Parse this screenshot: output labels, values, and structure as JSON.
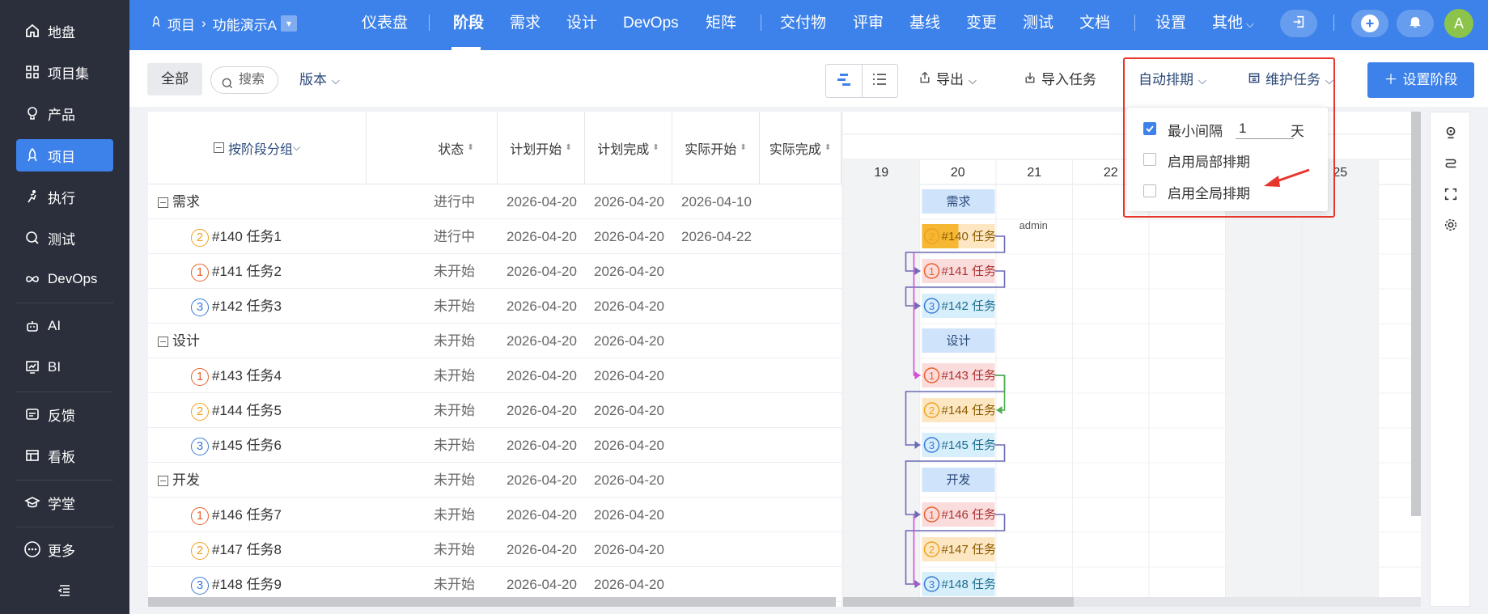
{
  "sidebar": {
    "items": [
      {
        "label": "地盘",
        "icon": "home-icon"
      },
      {
        "label": "项目集",
        "icon": "grid-icon"
      },
      {
        "label": "产品",
        "icon": "bulb-icon"
      },
      {
        "label": "项目",
        "icon": "rocket-icon"
      },
      {
        "label": "执行",
        "icon": "run-icon"
      },
      {
        "label": "测试",
        "icon": "test-icon"
      },
      {
        "label": "DevOps",
        "icon": "infinity-icon"
      },
      {
        "label": "AI",
        "icon": "robot-icon"
      },
      {
        "label": "BI",
        "icon": "chart-icon"
      },
      {
        "label": "反馈",
        "icon": "feedback-icon"
      },
      {
        "label": "看板",
        "icon": "kanban-icon"
      },
      {
        "label": "学堂",
        "icon": "school-icon"
      },
      {
        "label": "更多",
        "icon": "more-icon"
      }
    ],
    "collapse_icon": "collapse-icon"
  },
  "topbar": {
    "breadcrumb": [
      "项目",
      "功能演示A"
    ],
    "nav": [
      "仪表盘",
      "阶段",
      "需求",
      "设计",
      "DevOps",
      "矩阵",
      "交付物",
      "评审",
      "基线",
      "变更",
      "测试",
      "文档",
      "设置",
      "其他"
    ],
    "active": "阶段",
    "avatar": "A"
  },
  "toolbar": {
    "all": "全部",
    "search_placeholder": "搜索",
    "version": "版本",
    "export": "导出",
    "import": "导入任务",
    "auto_schedule": "自动排期",
    "maintain": "维护任务",
    "set_phase": "设置阶段"
  },
  "popup": {
    "min_gap_label": "最小间隔",
    "min_gap_value": "1",
    "min_gap_unit": "天",
    "local": "启用局部排期",
    "global": "启用全局排期"
  },
  "grid": {
    "headers": {
      "group": "按阶段分组",
      "status": "状态",
      "plan_start": "计划开始",
      "plan_end": "计划完成",
      "actual_start": "实际开始",
      "actual_end": "实际完成"
    },
    "rows": [
      {
        "type": "phase",
        "name": "需求",
        "status": "进行中",
        "ps": "2026-04-20",
        "pe": "2026-04-20",
        "as": "2026-04-10"
      },
      {
        "type": "task",
        "pri": "2",
        "name": "#140 任务1",
        "status": "进行中",
        "ps": "2026-04-20",
        "pe": "2026-04-20",
        "as": "2026-04-22"
      },
      {
        "type": "task",
        "pri": "1",
        "name": "#141 任务2",
        "status": "未开始",
        "ps": "2026-04-20",
        "pe": "2026-04-20",
        "as": ""
      },
      {
        "type": "task",
        "pri": "3",
        "name": "#142 任务3",
        "status": "未开始",
        "ps": "2026-04-20",
        "pe": "2026-04-20",
        "as": ""
      },
      {
        "type": "phase",
        "name": "设计",
        "status": "未开始",
        "ps": "2026-04-20",
        "pe": "2026-04-20",
        "as": ""
      },
      {
        "type": "task",
        "pri": "1",
        "name": "#143 任务4",
        "status": "未开始",
        "ps": "2026-04-20",
        "pe": "2026-04-20",
        "as": ""
      },
      {
        "type": "task",
        "pri": "2",
        "name": "#144 任务5",
        "status": "未开始",
        "ps": "2026-04-20",
        "pe": "2026-04-20",
        "as": ""
      },
      {
        "type": "task",
        "pri": "3",
        "name": "#145 任务6",
        "status": "未开始",
        "ps": "2026-04-20",
        "pe": "2026-04-20",
        "as": ""
      },
      {
        "type": "phase",
        "name": "开发",
        "status": "未开始",
        "ps": "2026-04-20",
        "pe": "2026-04-20",
        "as": ""
      },
      {
        "type": "task",
        "pri": "1",
        "name": "#146 任务7",
        "status": "未开始",
        "ps": "2026-04-20",
        "pe": "2026-04-20",
        "as": ""
      },
      {
        "type": "task",
        "pri": "2",
        "name": "#147 任务8",
        "status": "未开始",
        "ps": "2026-04-20",
        "pe": "2026-04-20",
        "as": ""
      },
      {
        "type": "task",
        "pri": "3",
        "name": "#148 任务9",
        "status": "未开始",
        "ps": "2026-04-20",
        "pe": "2026-04-20",
        "as": ""
      }
    ]
  },
  "gantt": {
    "days": [
      "19",
      "20",
      "21",
      "22",
      "25"
    ],
    "bars": [
      {
        "label": "需求",
        "kind": "phase"
      },
      {
        "label": "#140 任务",
        "pri": "2",
        "kind": "task"
      },
      {
        "label": "#141 任务",
        "pri": "1",
        "kind": "task"
      },
      {
        "label": "#142 任务",
        "pri": "3",
        "kind": "task"
      },
      {
        "label": "设计",
        "kind": "phase"
      },
      {
        "label": "#143 任务",
        "pri": "1",
        "kind": "task"
      },
      {
        "label": "#144 任务",
        "pri": "2",
        "kind": "task"
      },
      {
        "label": "#145 任务",
        "pri": "3",
        "kind": "task"
      },
      {
        "label": "开发",
        "kind": "phase"
      },
      {
        "label": "#146 任务",
        "pri": "1",
        "kind": "task"
      },
      {
        "label": "#147 任务",
        "pri": "2",
        "kind": "task"
      },
      {
        "label": "#148 任务",
        "pri": "3",
        "kind": "task"
      }
    ],
    "assignee": "admin"
  },
  "colors": {
    "primary": "#3d82ea",
    "sidebar": "#2a2f3b",
    "highlight": "#e8352c"
  }
}
